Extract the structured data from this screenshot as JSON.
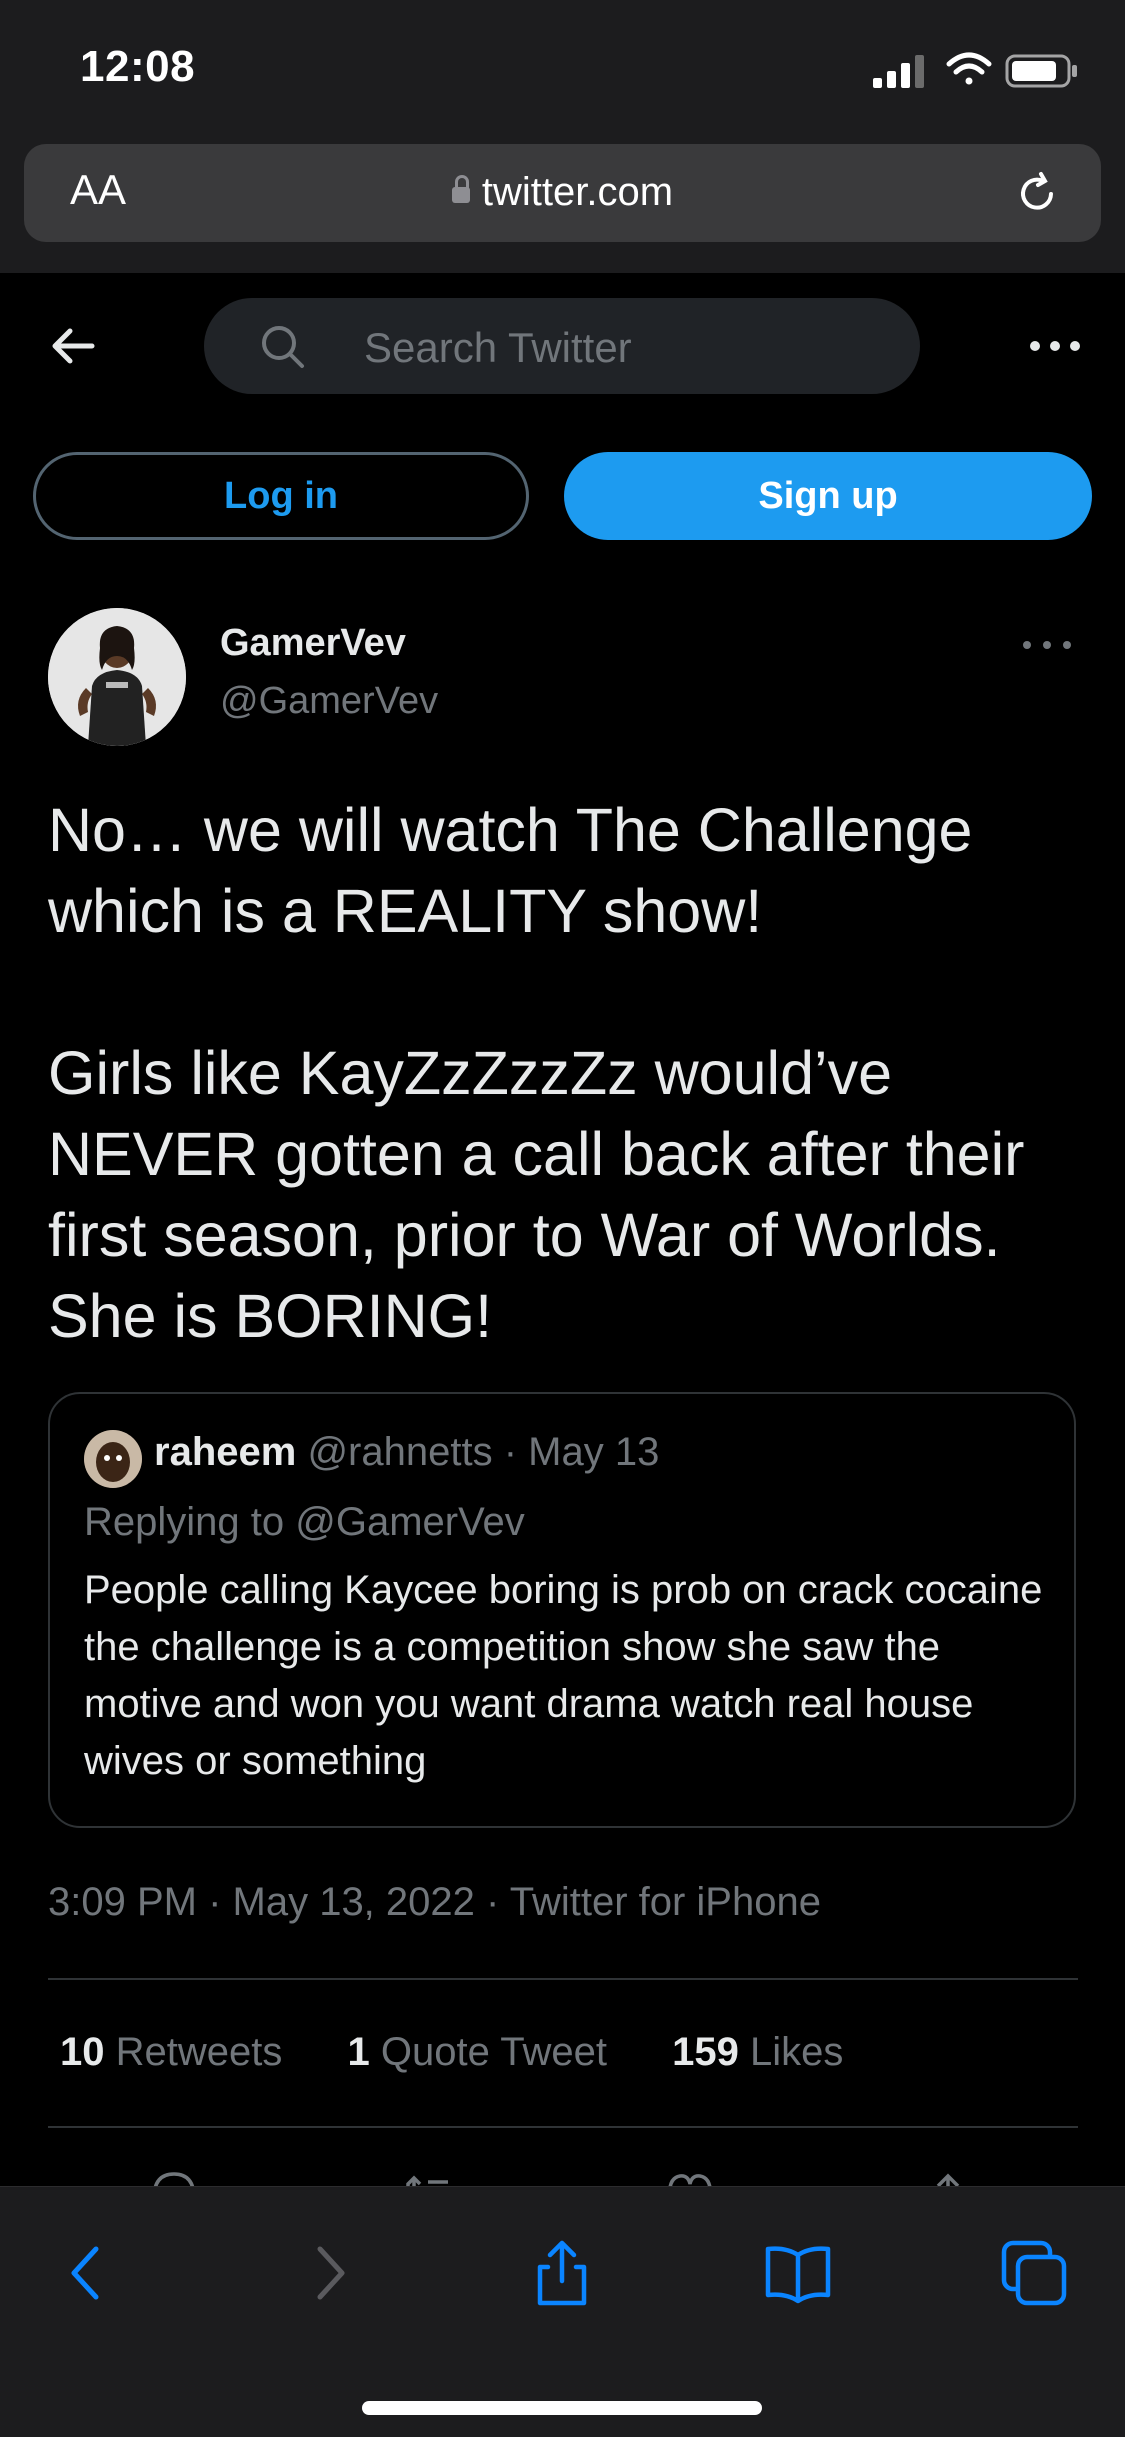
{
  "status_bar": {
    "time": "12:08"
  },
  "browser": {
    "text_size_label": "AA",
    "url": "twitter.com"
  },
  "twitter_header": {
    "search_placeholder": "Search Twitter"
  },
  "auth": {
    "login_label": "Log in",
    "signup_label": "Sign up"
  },
  "tweet": {
    "display_name": "GamerVev",
    "handle": "@GamerVev",
    "text": "No… we will watch The Challenge which is a REALITY show!\n\nGirls like KayZzZzzZz would’ve NEVER gotten a call back after their first season, prior to War of Worlds. She is BORING!",
    "quote": {
      "display_name": "raheem",
      "handle": "@rahnetts",
      "separator": "·",
      "date": "May 13",
      "replying_to": "Replying to @GamerVev",
      "text": "People calling Kaycee boring is prob on crack cocaine the challenge is a competition show she saw the motive and won you want drama watch real house wives or something"
    },
    "meta": "3:09 PM · May 13, 2022 · Twitter for iPhone",
    "stats": {
      "retweets_count": "10",
      "retweets_label": "Retweets",
      "quotes_count": "1",
      "quotes_label": "Quote Tweet",
      "likes_count": "159",
      "likes_label": "Likes"
    }
  },
  "colors": {
    "accent": "#1d9bf0",
    "safari_blue": "#0a84ff",
    "muted": "#71767b",
    "bar_bg": "#1c1c1e"
  },
  "icons": {
    "browser_toolbar": [
      "chevron-left-icon",
      "chevron-right-icon",
      "share-icon",
      "book-icon",
      "tabs-icon"
    ],
    "tweet_actions": [
      "reply-icon",
      "retweet-icon",
      "like-icon",
      "share-icon"
    ]
  }
}
